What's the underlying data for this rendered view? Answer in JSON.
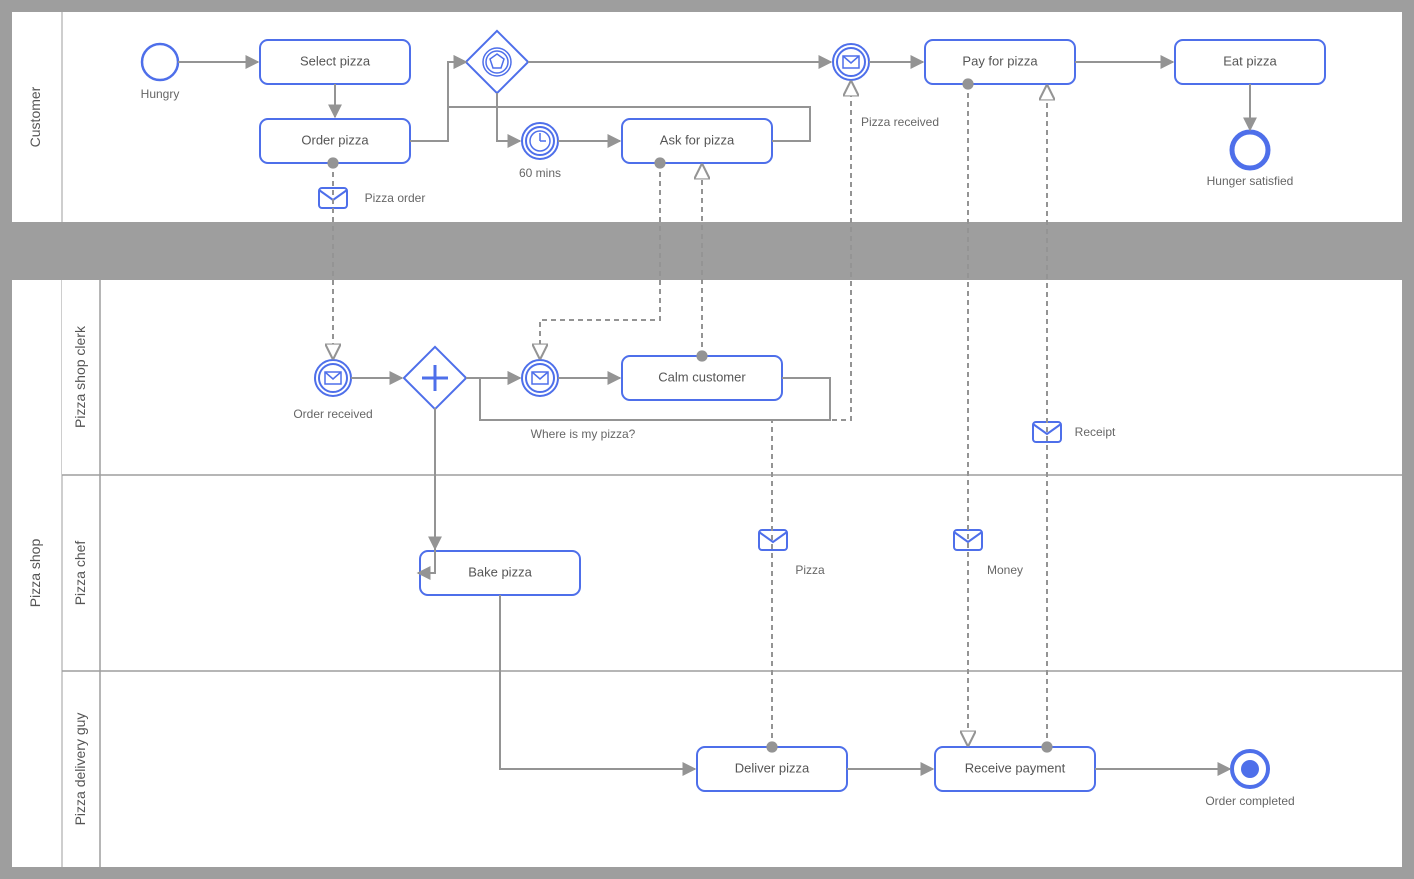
{
  "pools": {
    "customer": "Customer",
    "shop": "Pizza shop"
  },
  "lanes": {
    "clerk": "Pizza shop clerk",
    "chef": "Pizza chef",
    "delivery": "Pizza delivery guy"
  },
  "nodes": {
    "hungry": "Hungry",
    "select_pizza": "Select pizza",
    "order_pizza": "Order pizza",
    "sixty_mins": "60 mins",
    "ask_for_pizza": "Ask for pizza",
    "pizza_received": "Pizza received",
    "pay_for_pizza": "Pay for pizza",
    "eat_pizza": "Eat pizza",
    "hunger_satisfied": "Hunger satisfied",
    "order_received": "Order received",
    "where_is_my_pizza": "Where is my pizza?",
    "calm_customer": "Calm customer",
    "bake_pizza": "Bake pizza",
    "deliver_pizza": "Deliver pizza",
    "receive_payment": "Receive payment",
    "order_completed": "Order completed"
  },
  "messages": {
    "pizza_order": "Pizza order",
    "receipt": "Receipt",
    "pizza": "Pizza",
    "money": "Money"
  },
  "colors": {
    "blue": "#4e6fea",
    "grey": "#949494",
    "lightgrey": "#d9d9d9",
    "text": "#555"
  }
}
